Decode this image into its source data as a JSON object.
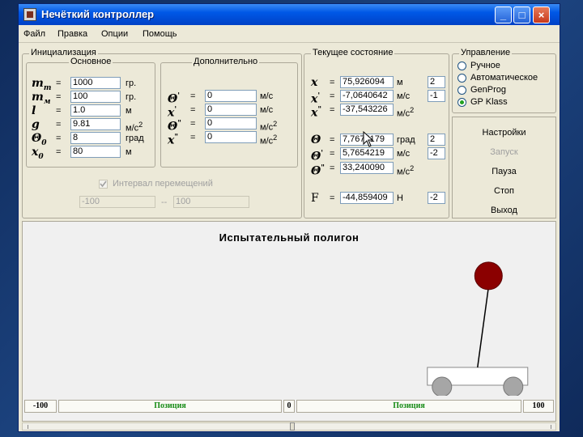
{
  "window": {
    "title": "Нечёткий контроллер",
    "controls": {
      "minimize": "_",
      "maximize": "□",
      "close": "×"
    }
  },
  "menu": [
    "Файл",
    "Правка",
    "Опции",
    "Помощь"
  ],
  "init": {
    "title": "Инициализация",
    "main_title": "Основное",
    "main_rows": [
      {
        "sym": "m",
        "sub": "т",
        "value": "1000",
        "unit": "гр."
      },
      {
        "sym": "m",
        "sub": "м",
        "value": "100",
        "unit": "гр."
      },
      {
        "sym": "l",
        "sub": "",
        "value": "1.0",
        "unit": "м"
      },
      {
        "sym": "g",
        "sub": "",
        "value": "9.81",
        "unit": "м/с",
        "sup": "2"
      },
      {
        "sym": "Θ",
        "sub": "0",
        "value": "8",
        "unit": "град"
      },
      {
        "sym": "x",
        "sub": "0",
        "value": "80",
        "unit": "м"
      }
    ],
    "extra_title": "Дополнительно",
    "extra_rows": [
      {
        "sym": "Θ",
        "prime": "'",
        "value": "0",
        "unit": "м/с"
      },
      {
        "sym": "x",
        "prime": "'",
        "value": "0",
        "unit": "м/с"
      },
      {
        "sym": "Θ",
        "prime": "\"",
        "value": "0",
        "unit": "м/с",
        "sup": "2"
      },
      {
        "sym": "x",
        "prime": "\"",
        "value": "0",
        "unit": "м/с",
        "sup": "2"
      }
    ],
    "interval_label": "Интервал перемещений",
    "interval_from": "-100",
    "interval_sep": "--",
    "interval_to": "100"
  },
  "state": {
    "title": "Текущее состояние",
    "rows": [
      {
        "sym": "x",
        "prime": "",
        "value": "75,926094",
        "unit": "м",
        "sup": "",
        "level": "2"
      },
      {
        "sym": "x",
        "prime": "'",
        "value": "-7,0640642",
        "unit": "м/с",
        "sup": "",
        "level": "-1"
      },
      {
        "sym": "x",
        "prime": "\"",
        "value": "-37,543226",
        "unit": "м/с",
        "sup": "2",
        "level": ""
      },
      {
        "sym": "Θ",
        "prime": "",
        "value": "7,7675179",
        "unit": "град",
        "sup": "",
        "level": "2"
      },
      {
        "sym": "Θ",
        "prime": "'",
        "value": "5,7654219",
        "unit": "м/с",
        "sup": "",
        "level": "-2"
      },
      {
        "sym": "Θ",
        "prime": "\"",
        "value": "33,240090",
        "unit": "м/с",
        "sup": "2",
        "level": ""
      },
      {
        "sym": "F",
        "prime": "",
        "value": "-44,859409",
        "unit": "Н",
        "sup": "",
        "level": "-2"
      }
    ]
  },
  "control": {
    "title": "Управление",
    "options": [
      {
        "label": "Ручное",
        "checked": false
      },
      {
        "label": "Автоматическое",
        "checked": false
      },
      {
        "label": "GenProg",
        "checked": false
      },
      {
        "label": "GP Klass",
        "checked": true
      }
    ]
  },
  "commands": [
    {
      "label": "Настройки",
      "enabled": true
    },
    {
      "label": "Запуск",
      "enabled": false
    },
    {
      "label": "Пауза",
      "enabled": true
    },
    {
      "label": "Стоп",
      "enabled": true
    },
    {
      "label": "Выход",
      "enabled": true
    }
  ],
  "arena": {
    "title": "Испытательный полигон",
    "left_value": "-100",
    "left_label": "Позиция",
    "center_value": "0",
    "right_label": "Позиция",
    "right_value": "100",
    "cart_position": 75.9,
    "pole_angle_deg": 7.77
  },
  "colors": {
    "titlebar": "#0058e6",
    "pendulum_ball": "#8b0000",
    "position_label": "#148a14"
  }
}
